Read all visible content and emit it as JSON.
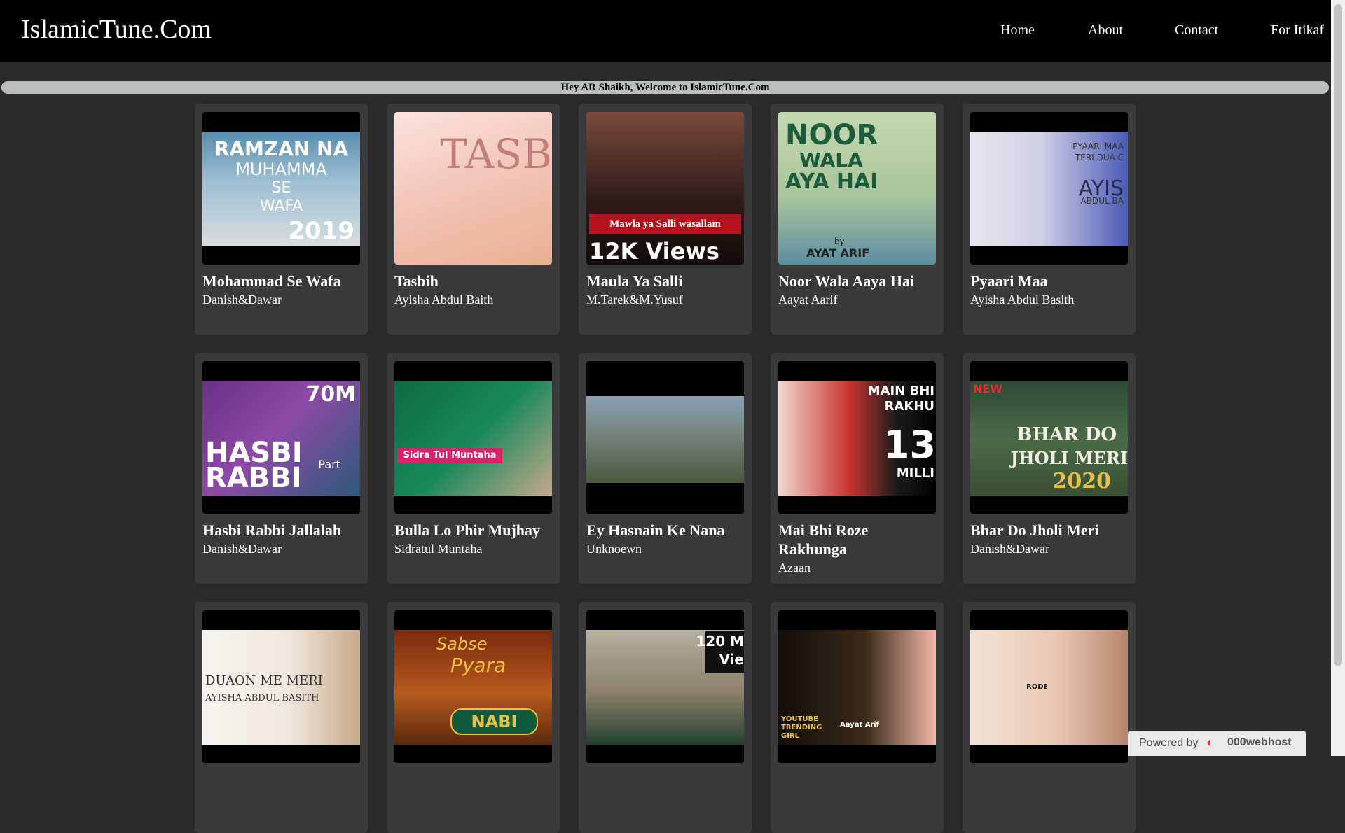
{
  "header": {
    "brand": "IslamicTune.Com",
    "nav": [
      "Home",
      "About",
      "Contact",
      "For Itikaf"
    ]
  },
  "welcome": "Hey AR Shaikh, Welcome to IslamicTune.Com",
  "cards": [
    {
      "title": "Mohammad Se Wafa",
      "artist": "Danish&Dawar",
      "thumb_text": [
        "RAMZAN NA",
        "MUHAMMA",
        "SE",
        "WAFA",
        "2019"
      ]
    },
    {
      "title": "Tasbih",
      "artist": "Ayisha Abdul Baith",
      "thumb_text": [
        "TASB"
      ]
    },
    {
      "title": "Maula Ya Salli",
      "artist": "M.Tarek&M.Yusuf",
      "thumb_text": [
        "Mawla ya Salli wasallam",
        "12K Views"
      ]
    },
    {
      "title": "Noor Wala Aaya Hai",
      "artist": "Aayat Aarif",
      "thumb_text": [
        "NOOR",
        "WALA",
        "AYA HAI",
        "by",
        "AYAT ARIF"
      ]
    },
    {
      "title": "Pyaari Maa",
      "artist": "Ayisha Abdul Basith",
      "thumb_text": [
        "PYAARI MAA",
        "TERI DUA C",
        "AYIS",
        "ABDUL BA"
      ]
    },
    {
      "title": "Hasbi Rabbi Jallalah",
      "artist": "Danish&Dawar",
      "thumb_text": [
        "70M",
        "HASBI",
        "RABBI",
        "Part"
      ]
    },
    {
      "title": "Bulla Lo Phir Mujhay",
      "artist": "Sidratul Muntaha",
      "thumb_text": [
        "Sidra Tul Muntaha"
      ]
    },
    {
      "title": "Ey Hasnain Ke Nana",
      "artist": "Unknoewn",
      "thumb_text": []
    },
    {
      "title": "Mai Bhi Roze Rakhunga",
      "artist": "Azaan",
      "thumb_text": [
        "MAIN BHI",
        "RAKHU",
        "13",
        "MILLI"
      ]
    },
    {
      "title": "Bhar Do Jholi Meri",
      "artist": "Danish&Dawar",
      "thumb_text": [
        "NEW",
        "BHAR DO",
        "JHOLI MERI",
        "2020"
      ]
    },
    {
      "title": "",
      "artist": "",
      "thumb_text": [
        "DUAON ME MERI",
        "AYISHA ABDUL BASITH"
      ]
    },
    {
      "title": "",
      "artist": "",
      "thumb_text": [
        "Sabse",
        "Pyara",
        "NABI"
      ]
    },
    {
      "title": "",
      "artist": "",
      "thumb_text": [
        "120 M",
        "Vie"
      ]
    },
    {
      "title": "",
      "artist": "",
      "thumb_text": [
        "YOUTUBE TRENDING GIRL",
        "Aayat Arif"
      ]
    },
    {
      "title": "",
      "artist": "",
      "thumb_text": [
        "RODE"
      ]
    }
  ],
  "footer_badge": {
    "label": "Powered by",
    "host": "000webhost"
  },
  "colors": {
    "header_bg": "#000000",
    "page_bg": "#2b2b2b",
    "card_bg": "#3a3a3c",
    "welcome_bg": "#b9bec1"
  }
}
